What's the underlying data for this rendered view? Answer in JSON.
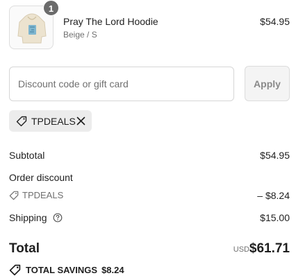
{
  "line_item": {
    "quantity": "1",
    "name": "Pray The Lord Hoodie",
    "variant": "Beige / S",
    "price": "$54.95"
  },
  "discount": {
    "placeholder": "Discount code or gift card",
    "apply_label": "Apply",
    "applied_code": "TPDEALS"
  },
  "summary": {
    "subtotal_label": "Subtotal",
    "subtotal_value": "$54.95",
    "order_discount_label": "Order discount",
    "discount_code": "TPDEALS",
    "discount_value": "– $8.24",
    "shipping_label": "Shipping",
    "shipping_value": "$15.00",
    "total_label": "Total",
    "currency": "USD",
    "total_value": "$61.71",
    "savings_label": "TOTAL SAVINGS",
    "savings_value": "$8.24"
  }
}
